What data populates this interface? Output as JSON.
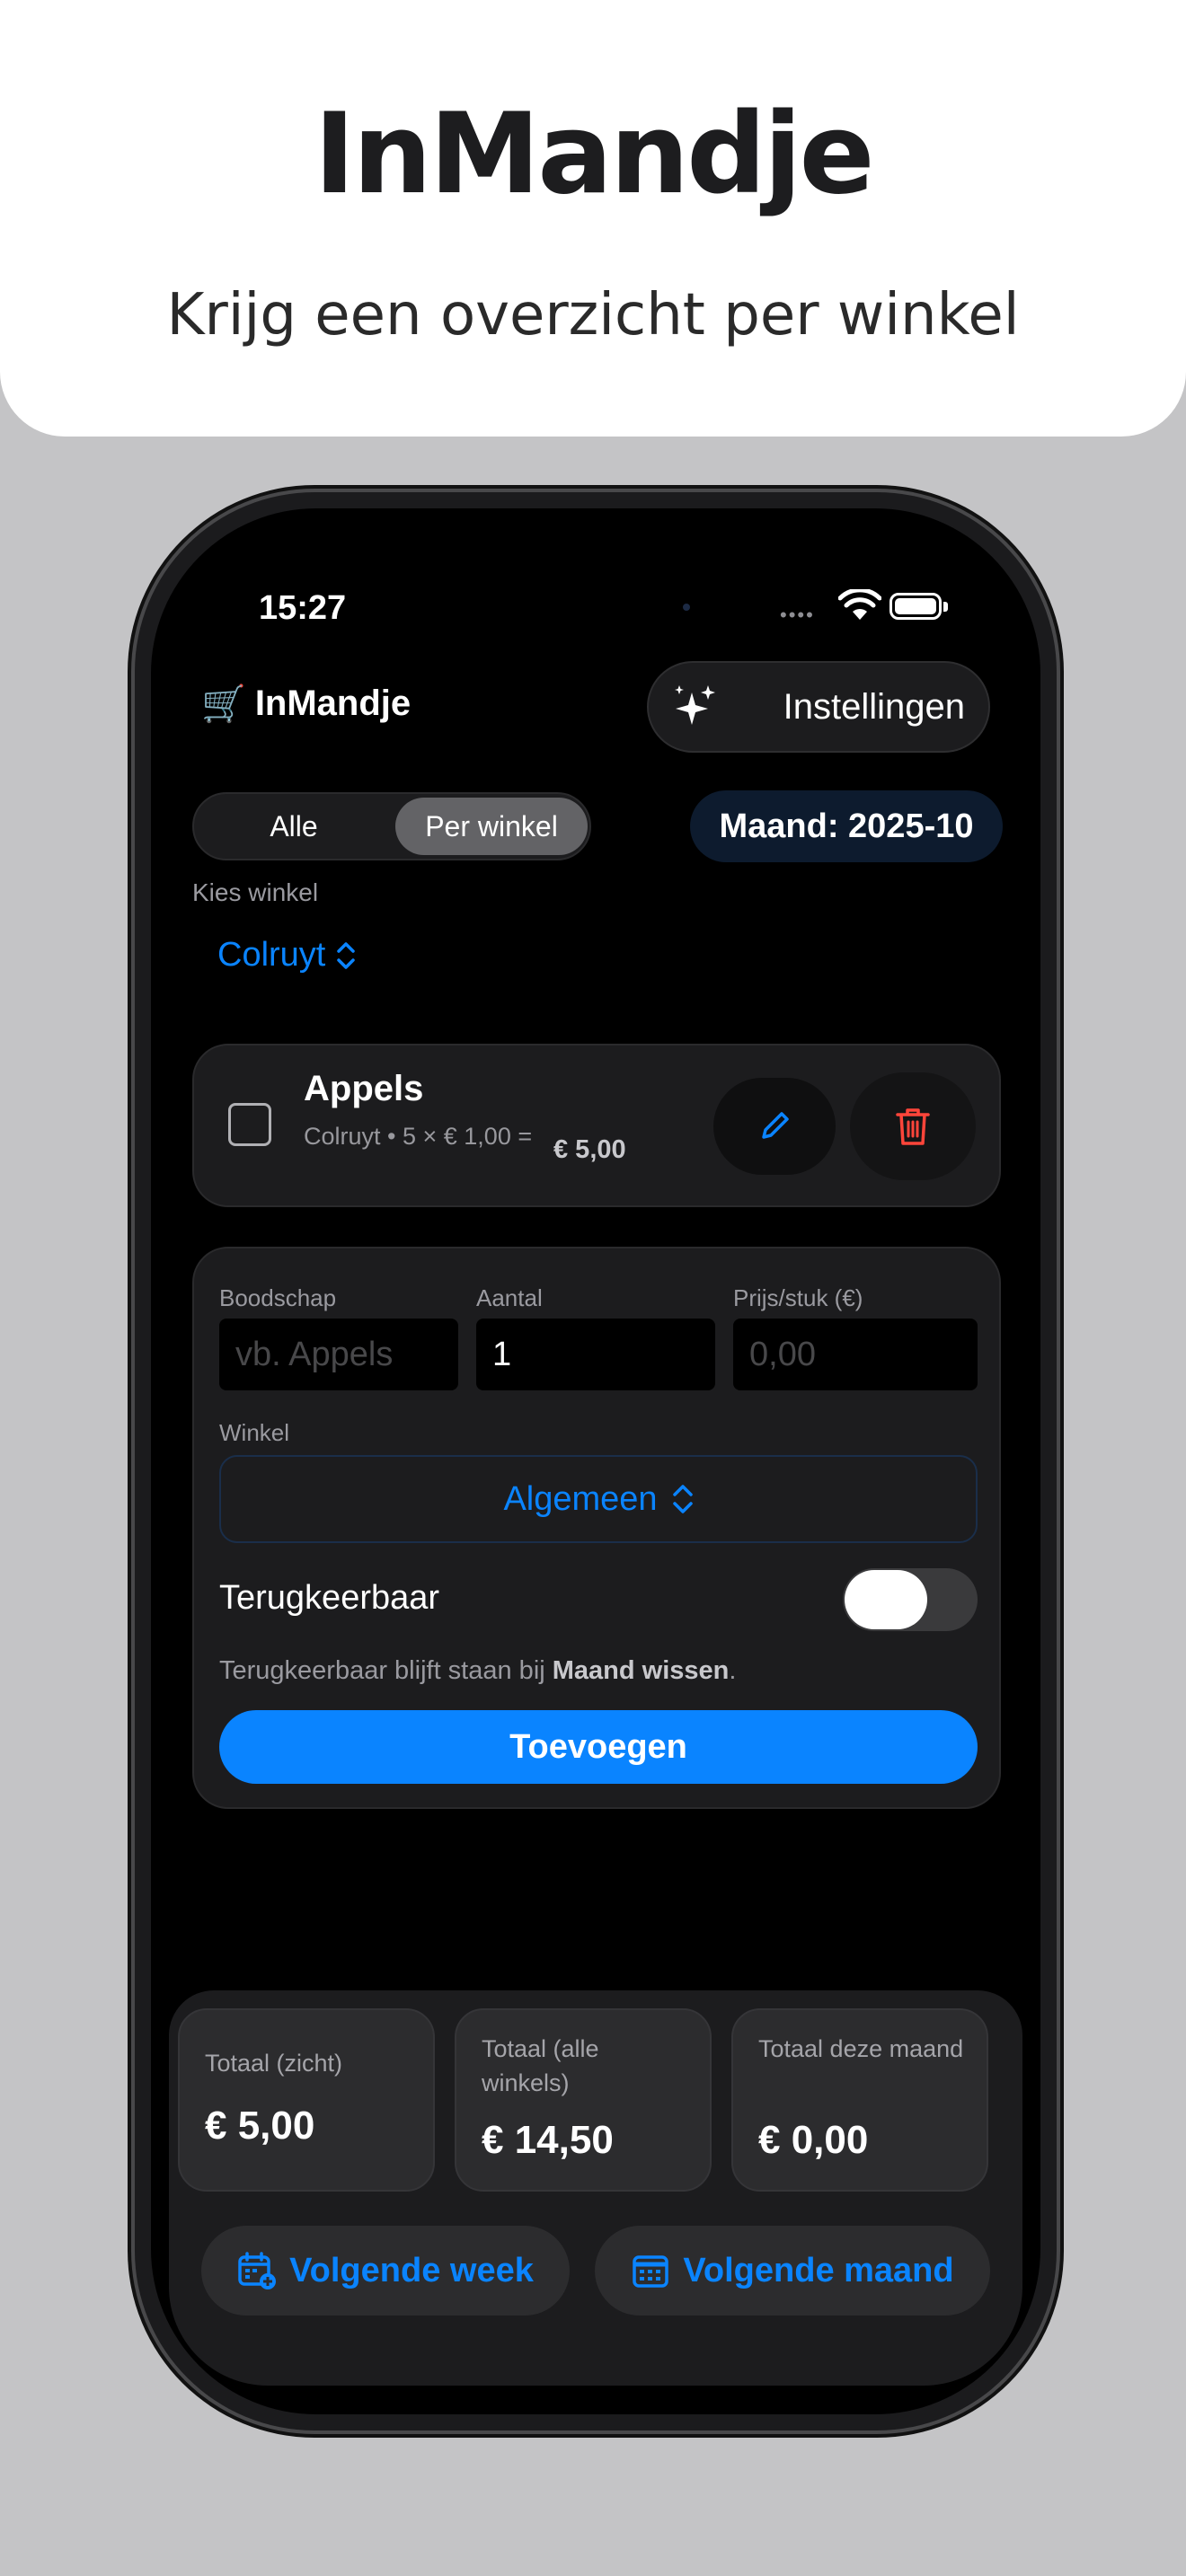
{
  "hero": {
    "title": "InMandje",
    "subtitle": "Krijg een overzicht per winkel"
  },
  "status_bar": {
    "time": "15:27"
  },
  "header": {
    "app_name": "InMandje",
    "cart_icon": "🛒",
    "settings_label": "Instellingen",
    "settings_icon": "sparkles-icon"
  },
  "filter": {
    "segments": [
      "Alle",
      "Per winkel"
    ],
    "selected": "Per winkel",
    "month_badge": "Maand: 2025-10"
  },
  "store_picker": {
    "label": "Kies winkel",
    "value": "Colruyt",
    "chevron": "⌃⌄"
  },
  "item": {
    "name": "Appels",
    "detail": "Colruyt • 5 × € 1,00 =",
    "total": "€ 5,00",
    "checked": false
  },
  "form": {
    "item_label": "Boodschap",
    "item_placeholder": "vb. Appels",
    "qty_label": "Aantal",
    "qty_value": "1",
    "price_label": "Prijs/stuk (€)",
    "price_placeholder": "0,00",
    "store_label": "Winkel",
    "store_value": "Algemeen",
    "recurring_label": "Terugkeerbaar",
    "recurring_on": false,
    "hint_prefix": "Terugkeerbaar blijft staan bij ",
    "hint_bold": "Maand wissen",
    "hint_suffix": ".",
    "add_label": "Toevoegen"
  },
  "totals": [
    {
      "label": "Totaal (zicht)",
      "value": "€ 5,00"
    },
    {
      "label": "Totaal (alle winkels)",
      "value": "€ 14,50"
    },
    {
      "label": "Totaal deze maand",
      "value": "€ 0,00"
    }
  ],
  "nav": {
    "next_week": "Volgende week",
    "next_month": "Volgende maand"
  },
  "colors": {
    "accent": "#0a84ff",
    "danger": "#ff453a",
    "background": "#000000",
    "card": "#1c1c1e"
  }
}
